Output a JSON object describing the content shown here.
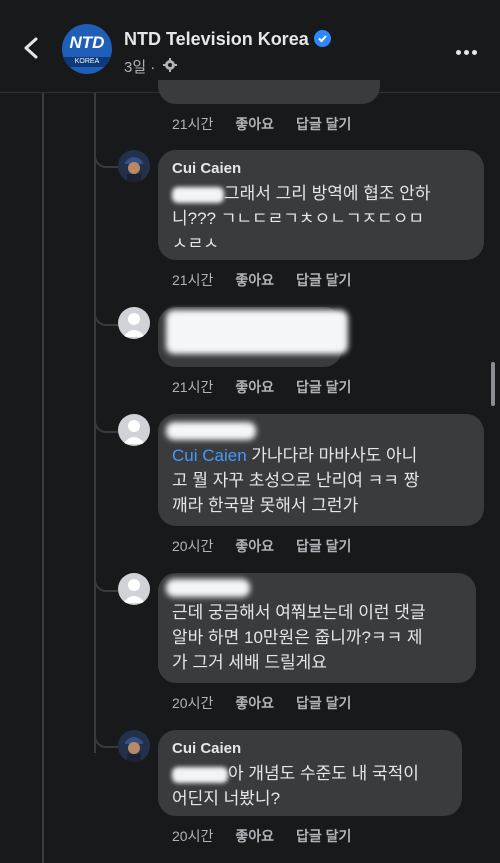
{
  "header": {
    "page_name": "NTD Television Korea",
    "logo_text": "NTD",
    "logo_sub": "KOREA",
    "time": "3일 ·",
    "back_icon": "back-arrow-icon",
    "more_icon": "more-icon"
  },
  "labels": {
    "like": "좋아요",
    "reply": "답글 달기"
  },
  "comments": [
    {
      "time": "21시간"
    },
    {
      "author": "Cui Caien",
      "text": "그래서 그리 방역에 협조 안하니??? ㄱㄴㄷㄹㄱㅊㅇㄴㄱㅈㄷㅇㅁㅅㄹㅅ",
      "line1": "그래서 그리 방역에 협조 안하",
      "line2": "니??? ㄱㄴㄷㄹㄱㅊㅇㄴㄱㅈㄷㅇㅁ",
      "line3": "ㅅㄹㅅ",
      "time": "21시간"
    },
    {
      "time": "21시간"
    },
    {
      "mention": "Cui Caien",
      "line1": " 가나다라 마바사도 아니",
      "line2": "고 뭘 자꾸 초성으로 난리여 ㅋㅋ 짱",
      "line3": "깨라 한국말 못해서 그런가",
      "time": "20시간"
    },
    {
      "line1": "근데 궁금해서 여쭤보는데 이런 댓글",
      "line2": "알바 하면 10만원은 줍니까?ㅋㅋ 제",
      "line3": "가 그거 세배 드릴게요",
      "time": "20시간"
    },
    {
      "author": "Cui Caien",
      "line1": "아 개념도 수준도 내 국적이",
      "line2": "어딘지 너봤니?",
      "time": "20시간"
    }
  ]
}
